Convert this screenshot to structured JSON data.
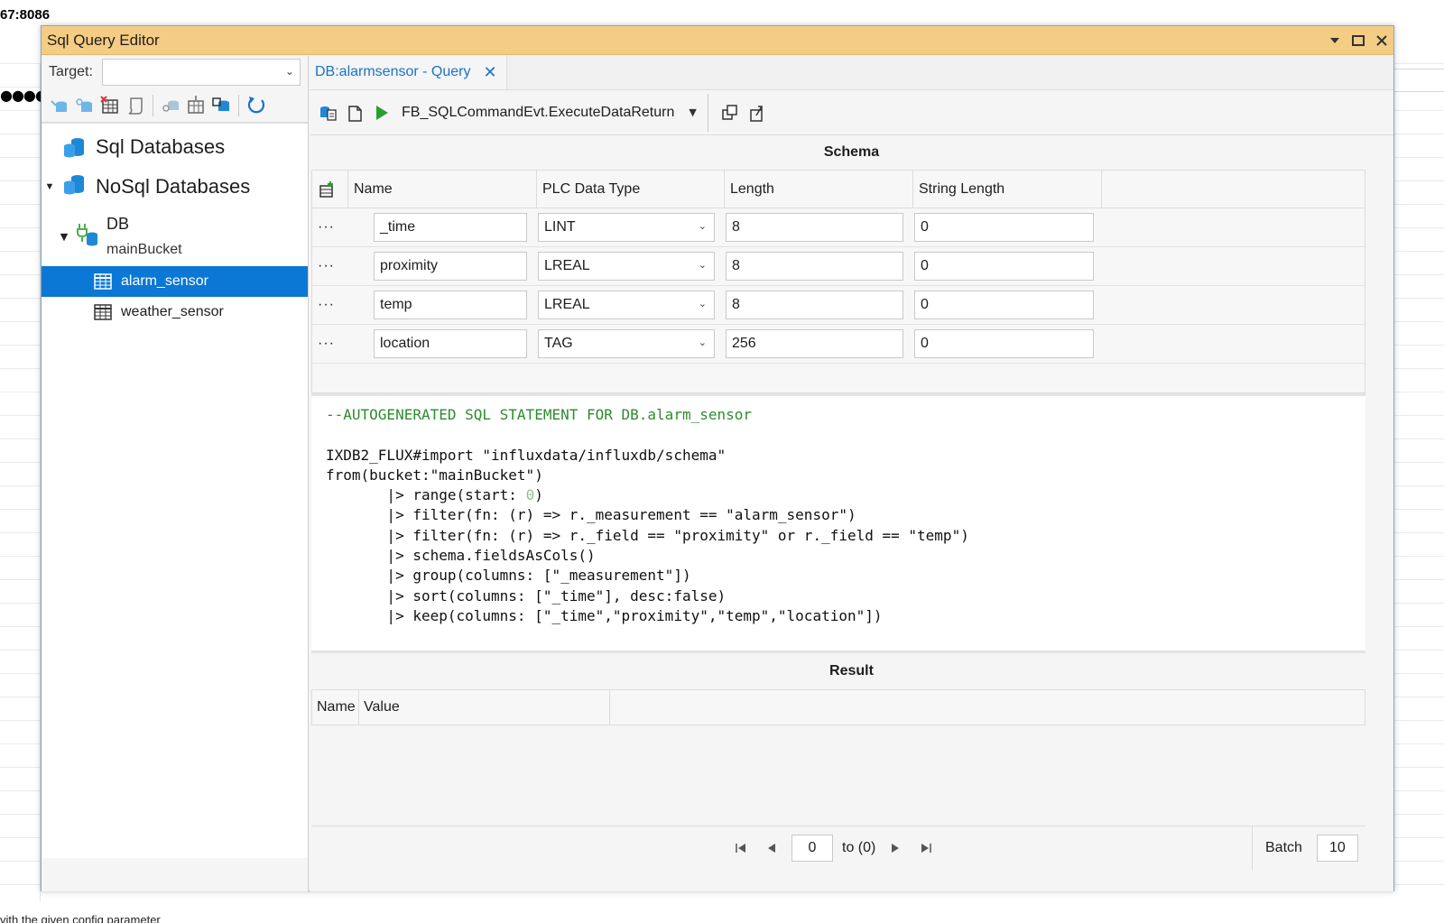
{
  "background": {
    "top_text": "67:8086",
    "bottom_text": "vith the given config parameter",
    "dots_text": "●●●●●"
  },
  "window": {
    "title": "Sql Query Editor",
    "controls": {
      "dropdown": "▾",
      "maximize": "☐",
      "close": "✕"
    }
  },
  "left_panel": {
    "target_label": "Target:",
    "target_value": "",
    "tree": {
      "sql_databases": "Sql Databases",
      "nosql_databases": "NoSql Databases",
      "db_name": "DB",
      "bucket_name": "mainBucket",
      "tables": [
        "alarm_sensor",
        "weather_sensor"
      ],
      "selected": "alarm_sensor"
    }
  },
  "query_tab": {
    "label": "DB:alarmsensor - Query",
    "close": "✕"
  },
  "query_toolbar": {
    "execute_label": "FB_SQLCommandEvt.ExecuteDataReturn"
  },
  "schema": {
    "title": "Schema",
    "columns": [
      "Name",
      "PLC Data Type",
      "Length",
      "String Length"
    ],
    "row_menu": "···",
    "rows": [
      {
        "name": "_time",
        "type": "LINT",
        "length": "8",
        "string_length": "0"
      },
      {
        "name": "proximity",
        "type": "LREAL",
        "length": "8",
        "string_length": "0"
      },
      {
        "name": "temp",
        "type": "LREAL",
        "length": "8",
        "string_length": "0"
      },
      {
        "name": "location",
        "type": "TAG",
        "length": "256",
        "string_length": "0"
      }
    ]
  },
  "code": {
    "comment": "--AUTOGENERATED SQL STATEMENT FOR DB.alarm_sensor",
    "line1": "IXDB2_FLUX#import \"influxdata/influxdb/schema\"",
    "line2": "from(bucket:\"mainBucket\")",
    "line3a": "       |> range(start: ",
    "line3num": "0",
    "line3b": ")",
    "line4": "       |> filter(fn: (r) => r._measurement == \"alarm_sensor\")",
    "line5": "       |> filter(fn: (r) => r._field == \"proximity\" or r._field == \"temp\")",
    "line6": "       |> schema.fieldsAsCols()",
    "line7": "       |> group(columns: [\"_measurement\"])",
    "line8": "       |> sort(columns: [\"_time\"], desc:false)",
    "line9": "       |> keep(columns: [\"_time\",\"proximity\",\"temp\",\"location\"])"
  },
  "result": {
    "title": "Result",
    "columns": [
      "Name",
      "Value"
    ]
  },
  "pager": {
    "page": "0",
    "to_label": "to (0)",
    "batch_label": "Batch",
    "batch_value": "10"
  },
  "colors": {
    "titlebar": "#f5cc84",
    "selection": "#0a78d4",
    "tab_text": "#1a73c8",
    "comment": "#2e8b2e",
    "run_green": "#2aa02a"
  }
}
